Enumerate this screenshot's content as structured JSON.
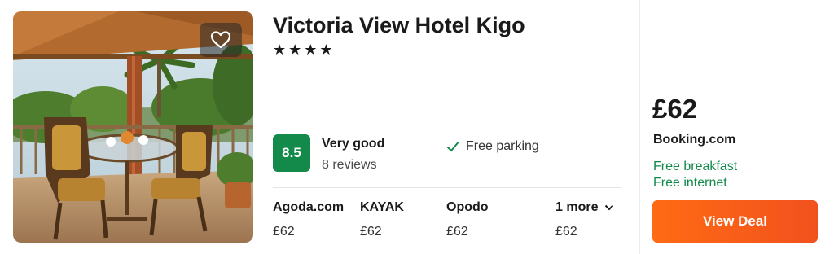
{
  "hotel": {
    "name": "Victoria View Hotel Kigo",
    "stars": "★★★★",
    "rating_score": "8.5",
    "rating_label": "Very good",
    "review_count": "8 reviews",
    "amenity": "Free parking"
  },
  "providers": [
    {
      "name": "Agoda.com",
      "price": "£62"
    },
    {
      "name": "KAYAK",
      "price": "£62"
    },
    {
      "name": "Opodo",
      "price": "£62"
    }
  ],
  "more": {
    "label": "1 more",
    "price": "£62"
  },
  "deal": {
    "price": "£62",
    "site": "Booking.com",
    "perks": [
      "Free breakfast",
      "Free internet"
    ],
    "button_label": "View Deal"
  },
  "colors": {
    "rating_green": "#138a4a",
    "deal_orange": "#ff6b14"
  },
  "icons": {
    "favorite": "heart-icon",
    "amenity": "check-icon",
    "more": "chevron-down-icon"
  }
}
